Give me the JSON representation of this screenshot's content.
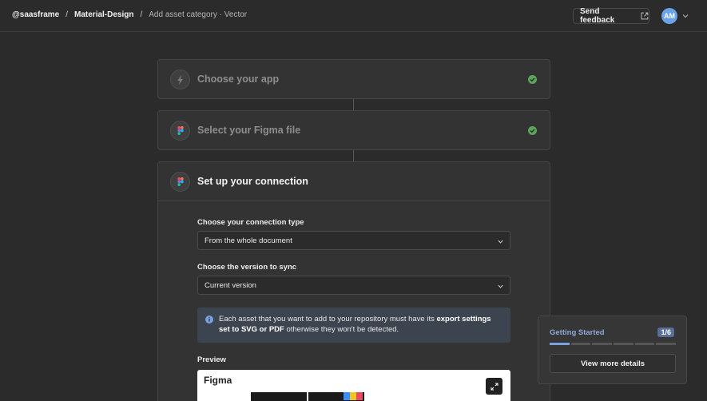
{
  "breadcrumb": {
    "org": "@saasframe",
    "project": "Material-Design",
    "page": "Add asset category · Vector",
    "separator": "/"
  },
  "header": {
    "feedback_label": "Send feedback",
    "avatar_initials": "AM",
    "avatar_color": "#6aa3e8"
  },
  "steps": [
    {
      "title": "Choose your app",
      "icon": "bolt-icon",
      "done": true
    },
    {
      "title": "Select your Figma file",
      "icon": "figma-icon",
      "done": true
    },
    {
      "title": "Set up your connection",
      "icon": "figma-icon",
      "done": false
    }
  ],
  "connection": {
    "type_label": "Choose your connection type",
    "type_value": "From the whole document",
    "version_label": "Choose the version to sync",
    "version_value": "Current version",
    "info_text_1": "Each asset that you want to add to your repository must have its ",
    "info_bold": "export settings set to SVG or PDF",
    "info_text_2": " otherwise they won't be detected.",
    "preview_label": "Preview",
    "preview_app": "Figma"
  },
  "getting_started": {
    "title": "Getting Started",
    "badge": "1/6",
    "progress": {
      "completed": 1,
      "total": 6
    },
    "button": "View more details",
    "accent": "#7aa2e0"
  },
  "colors": {
    "background": "#2b2b2b",
    "success": "#5aa55a"
  }
}
